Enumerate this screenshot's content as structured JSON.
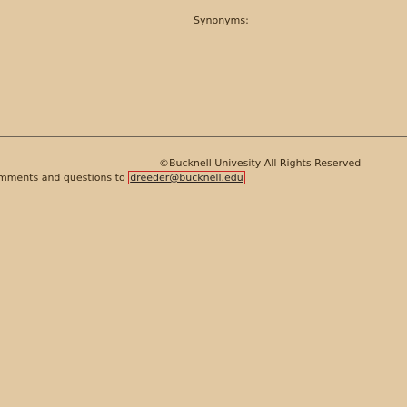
{
  "synonyms_label": "Synonyms:",
  "footer": {
    "copyright": "©Bucknell Univesity All Rights Reserved",
    "comments_prefix": "mments and questions to",
    "email_link": "dreeder@bucknell.edu"
  },
  "colors": {
    "background": "#e1c8a2",
    "focus_outline": "#cc2222",
    "divider": "#6e6456"
  }
}
